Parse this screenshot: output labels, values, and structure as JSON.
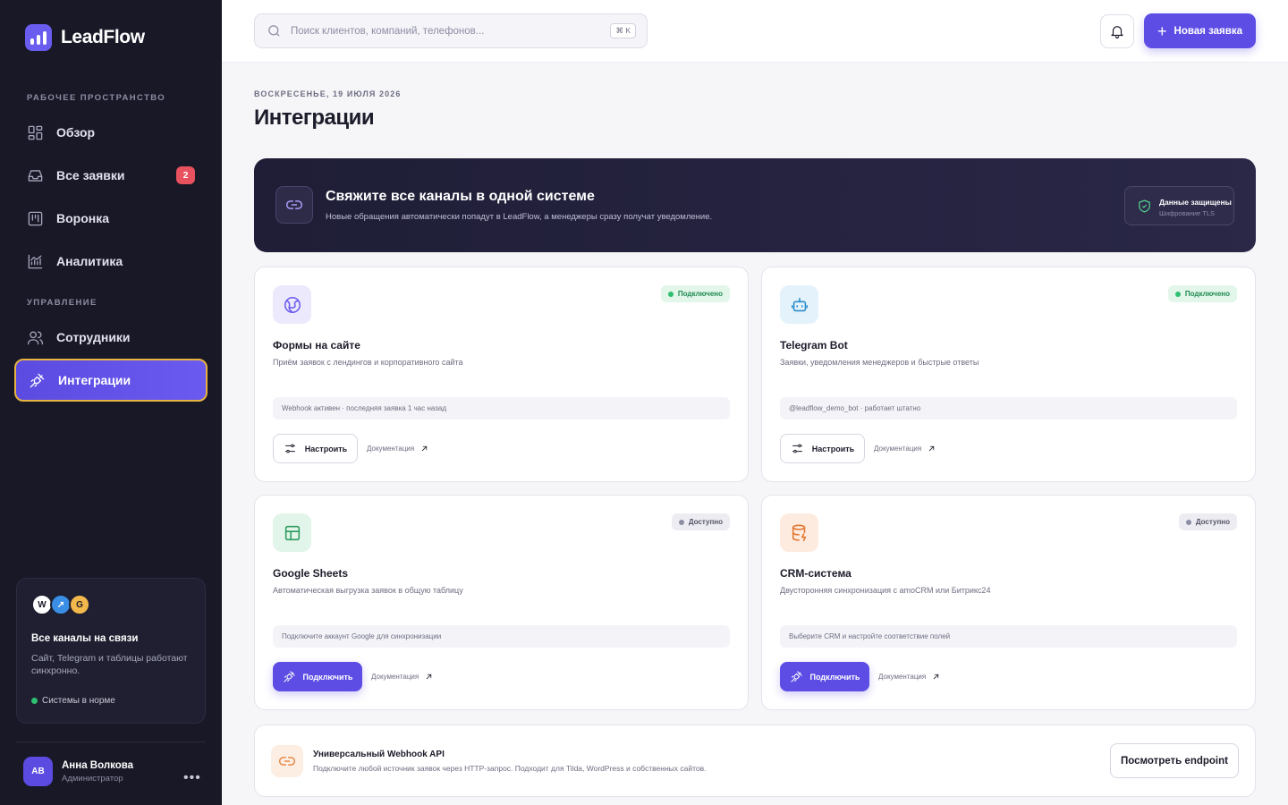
{
  "app": {
    "name": "LeadFlow"
  },
  "sidebar": {
    "section_workspace": "РАБОЧЕЕ ПРОСТРАНСТВО",
    "section_management": "УПРАВЛЕНИЕ",
    "items": [
      {
        "label": "Обзор",
        "icon": "grid-icon"
      },
      {
        "label": "Все заявки",
        "icon": "inbox-icon",
        "badge": "2"
      },
      {
        "label": "Воронка",
        "icon": "kanban-icon"
      },
      {
        "label": "Аналитика",
        "icon": "chart-icon"
      },
      {
        "label": "Сотрудники",
        "icon": "users-icon"
      },
      {
        "label": "Интеграции",
        "icon": "plug-icon",
        "active": true
      }
    ],
    "promo": {
      "avatars": [
        "W",
        "↗",
        "G"
      ],
      "title": "Все каналы на связи",
      "text": "Сайт, Telegram и таблицы работают синхронно.",
      "status": "Системы в норме"
    },
    "user": {
      "initials": "АВ",
      "name": "Анна Волкова",
      "role": "Администратор"
    }
  },
  "topbar": {
    "search_placeholder": "Поиск клиентов, компаний, телефонов...",
    "shortcut": "⌘ K",
    "new_button": "Новая заявка"
  },
  "page": {
    "date": "ВОСКРЕСЕНЬЕ, 19 ИЮЛЯ 2026",
    "title": "Интеграции"
  },
  "hero": {
    "title": "Свяжите все каналы в одной системе",
    "text": "Новые обращения автоматически попадут в LeadFlow, а менеджеры сразу получат уведомление.",
    "secure_title": "Данные защищены",
    "secure_sub": "Шифрование TLS"
  },
  "cards": [
    {
      "title": "Формы на сайте",
      "desc": "Приём заявок с лендингов и корпоративного сайта",
      "status": "Подключено",
      "info": "Webhook активен · последняя заявка 1 час назад",
      "action": "Настроить",
      "doc": "Документация",
      "icon": "globe-icon"
    },
    {
      "title": "Telegram Bot",
      "desc": "Заявки, уведомления менеджеров и быстрые ответы",
      "status": "Подключено",
      "info": "@leadflow_demo_bot · работает штатно",
      "action": "Настроить",
      "doc": "Документация",
      "icon": "bot-icon"
    },
    {
      "title": "Google Sheets",
      "desc": "Автоматическая выгрузка заявок в общую таблицу",
      "status": "Доступно",
      "info": "Подключите аккаунт Google для синхронизации",
      "action": "Подключить",
      "doc": "Документация",
      "icon": "table-icon"
    },
    {
      "title": "CRM-система",
      "desc": "Двусторонняя синхронизация с amoCRM или Битрикс24",
      "status": "Доступно",
      "info": "Выберите CRM и настройте соответствие полей",
      "action": "Подключить",
      "doc": "Документация",
      "icon": "database-icon"
    }
  ],
  "webhook": {
    "title": "Универсальный Webhook API",
    "text": "Подключите любой источник заявок через HTTP-запрос. Подходит для Tilda, WordPress и собственных сайтов.",
    "button": "Посмотреть endpoint"
  },
  "colors": {
    "accent": "#5d4de4",
    "sidebar_bg": "#181827",
    "active_border": "#e7b341",
    "status_connected": "#2fbf71",
    "badge": "#e8525e"
  }
}
